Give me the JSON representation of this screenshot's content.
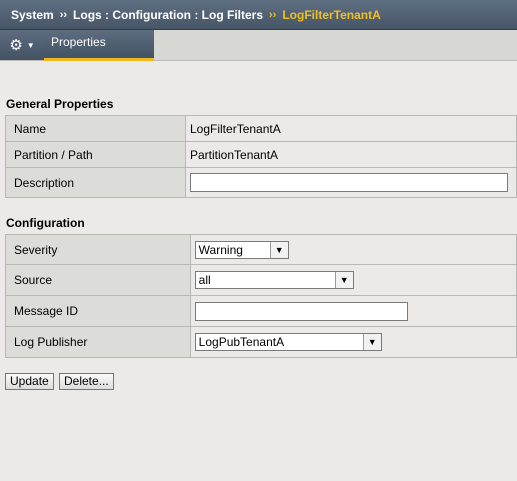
{
  "breadcrumb": {
    "items": [
      "System",
      "Logs : Configuration : Log Filters"
    ],
    "current": "LogFilterTenantA"
  },
  "tabs": {
    "properties_label": "Properties"
  },
  "general": {
    "title": "General Properties",
    "name_label": "Name",
    "name_value": "LogFilterTenantA",
    "partition_label": "Partition / Path",
    "partition_value": "PartitionTenantA",
    "description_label": "Description",
    "description_value": ""
  },
  "configuration": {
    "title": "Configuration",
    "severity_label": "Severity",
    "severity_value": "Warning",
    "source_label": "Source",
    "source_value": "all",
    "message_id_label": "Message ID",
    "message_id_value": "",
    "log_publisher_label": "Log Publisher",
    "log_publisher_value": "LogPubTenantA"
  },
  "buttons": {
    "update_label": "Update",
    "delete_label": "Delete..."
  },
  "colors": {
    "header_bg": "#4e5e70",
    "accent": "#f0c020",
    "page_bg": "#ebeae8"
  }
}
